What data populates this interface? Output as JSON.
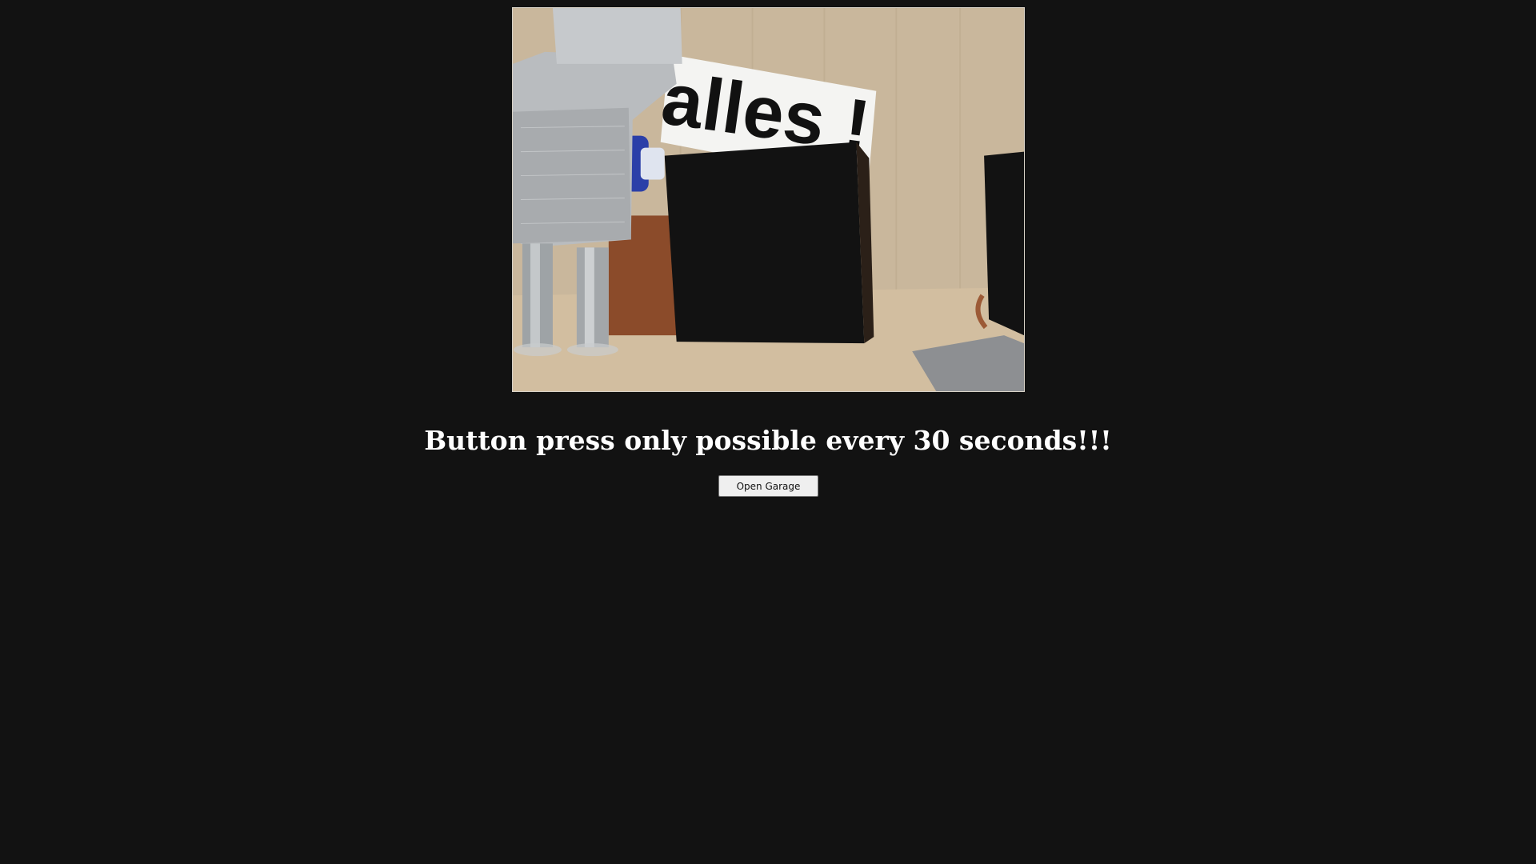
{
  "camera": {
    "sign_text": "alles !"
  },
  "notice": {
    "text": "Button press only possible every 30 seconds!!!"
  },
  "controls": {
    "open_garage_label": "Open Garage"
  },
  "colors": {
    "background": "#121212",
    "text": "#ffffff",
    "button_bg": "#efefef"
  }
}
